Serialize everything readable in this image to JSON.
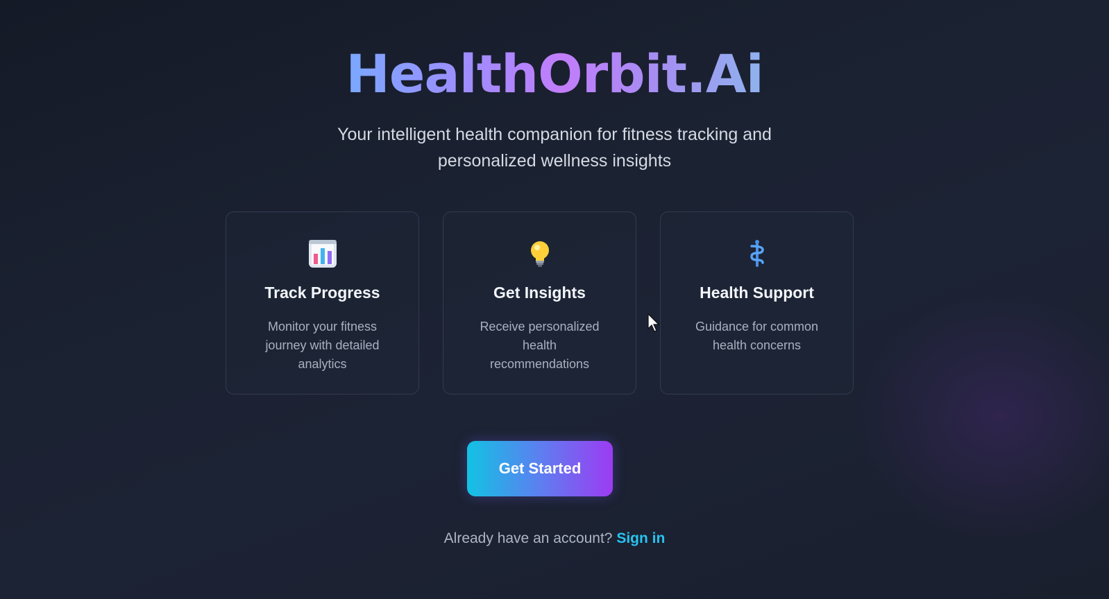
{
  "app": {
    "title": "HealthOrbit.Ai",
    "tagline": "Your intelligent health companion for fitness tracking and personalized wellness insights"
  },
  "features": [
    {
      "icon": "bar-chart-icon",
      "title": "Track Progress",
      "description": "Monitor your fitness journey with detailed analytics"
    },
    {
      "icon": "lightbulb-icon",
      "title": "Get Insights",
      "description": "Receive personalized health recommendations"
    },
    {
      "icon": "medical-staff-icon",
      "title": "Health Support",
      "description": "Guidance for common health concerns"
    }
  ],
  "cta": {
    "label": "Get Started"
  },
  "signin": {
    "prompt": "Already have an account?",
    "link_label": "Sign in"
  },
  "colors": {
    "accent_cyan": "#12c2e3",
    "accent_purple": "#9c3cf2",
    "link": "#27c4f0",
    "background": "#1b2232"
  }
}
